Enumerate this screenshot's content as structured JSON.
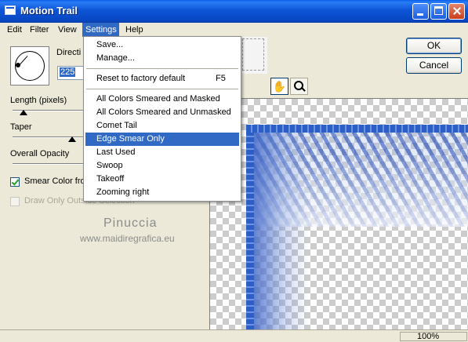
{
  "window": {
    "title": "Motion Trail"
  },
  "menubar": {
    "items": [
      "Edit",
      "Filter",
      "View",
      "Settings",
      "Help"
    ]
  },
  "settings_menu": {
    "items": [
      "Save...",
      "Manage...",
      "Reset to factory default",
      "All Colors Smeared and Masked",
      "All Colors Smeared and Unmasked",
      "Comet Tail",
      "Edge Smear Only",
      "Last Used",
      "Swoop",
      "Takeoff",
      "Zooming right"
    ],
    "shortcut": "F5",
    "highlighted": "Edge Smear Only"
  },
  "controls": {
    "direction_label": "Directi",
    "direction_value": "225",
    "length_label": "Length (pixels)",
    "taper_label": "Taper",
    "opacity_label": "Overall Opacity",
    "smear_label": "Smear Color fro",
    "outside_label": "Draw Only Outside Selection"
  },
  "buttons": {
    "ok": "OK",
    "cancel": "Cancel"
  },
  "watermark": {
    "name": "Pinuccia",
    "site": "www.maidiregrafica.eu"
  },
  "status": {
    "zoom": "100%"
  },
  "colors": {
    "titlebar": "#0a5fe8",
    "highlight": "#316ac5",
    "smear": "#2b5fc7"
  }
}
